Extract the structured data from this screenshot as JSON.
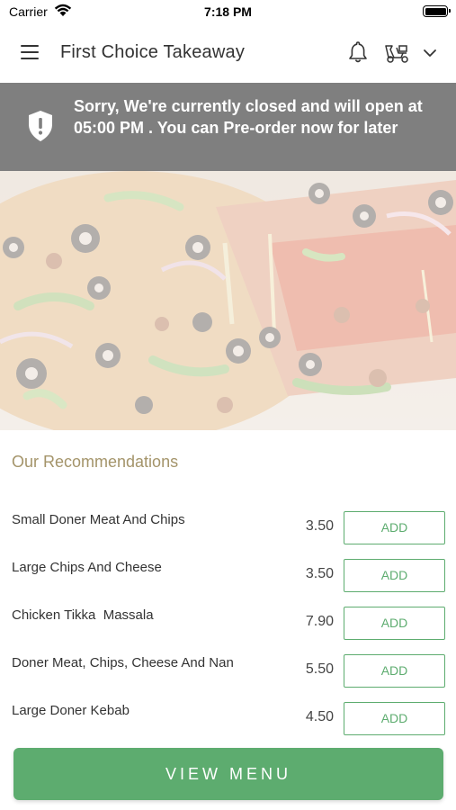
{
  "status_bar": {
    "carrier": "Carrier",
    "time": "7:18 PM"
  },
  "header": {
    "title": "First Choice Takeaway",
    "icons": [
      "menu-icon",
      "bell-icon",
      "language-icon",
      "chevron-down-icon"
    ]
  },
  "banner": {
    "icon": "shield-alert-icon",
    "message": "Sorry, We're currently closed and will open at 05:00 PM . You can Pre-order now for later"
  },
  "hero": {
    "image": "pizza-photo"
  },
  "recommendations": {
    "title": "Our Recommendations",
    "items": [
      {
        "name": "Small Doner Meat And Chips",
        "price": "3.50",
        "button": "ADD"
      },
      {
        "name": "Large Chips And Cheese",
        "price": "3.50",
        "button": "ADD"
      },
      {
        "name": "Chicken Tikka  Massala",
        "price": "7.90",
        "button": "ADD"
      },
      {
        "name": "Doner Meat, Chips, Cheese And Nan",
        "price": "5.50",
        "button": "ADD"
      },
      {
        "name": "Large Doner Kebab",
        "price": "4.50",
        "button": "ADD"
      }
    ]
  },
  "footer": {
    "view_menu_label": "VIEW MENU"
  },
  "colors": {
    "accent_green": "#5dac6f",
    "banner_gray": "#7f7f7f",
    "section_title": "#a4946a"
  }
}
